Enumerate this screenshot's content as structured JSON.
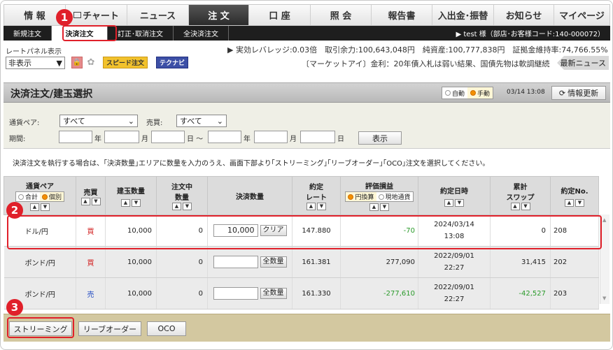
{
  "top_nav": [
    "情 報",
    "チャート",
    "ニュース",
    "注 文",
    "口 座",
    "照 会",
    "報告書",
    "入出金･振替",
    "お知らせ",
    "マイページ"
  ],
  "sub_nav": [
    "新規注文",
    "決済注文",
    "訂正･取消注文",
    "全決済注文"
  ],
  "user_text": "▶ test 様（部店･お客様コード:140-000072）",
  "rate_panel": {
    "label": "レートパネル表示",
    "value": "非表示"
  },
  "speed_order": "スピード注文",
  "technavi": "テクナビ",
  "leverage_text": "▶ 実効レバレッジ:0.03倍　取引余力:100,643,048円　純資産:100,777,838円　証拠金維持率:74,766.55%",
  "news_text": "〔マーケットアイ〕金利：20年債入札は弱い結果、国債先物は軟調継続",
  "news_button": "最新ニュース",
  "panel": {
    "title": "決済注文/建玉選択",
    "auto": "自動",
    "manual": "手動",
    "time": "03/14 13:08",
    "refresh": "情報更新"
  },
  "filter": {
    "pair_label": "通貨ペア:",
    "pair_value": "すべて",
    "side_label": "売買:",
    "side_value": "すべて",
    "period_label": "期間:",
    "year": "年",
    "month": "月",
    "day": "日 ～",
    "year2": "年",
    "month2": "月",
    "day2": "日",
    "show": "表示"
  },
  "note": "決済注文を執行する場合は、｢決済数量｣エリアに数量を入力のうえ、画面下部より｢ストリーミング｣｢リーブオーダー｣｢OCO｣注文を選択してください。",
  "table": {
    "headers": {
      "pair": "通貨ペア",
      "sum": "合計",
      "each": "個別",
      "side": "売買",
      "position_qty": "建玉数量",
      "ordering_qty_1": "注文中",
      "ordering_qty_2": "数量",
      "settle_qty": "決済数量",
      "rate_1": "約定",
      "rate_2": "レート",
      "pl": "評価損益",
      "pl_yen": "円換算",
      "pl_local": "現地通貨",
      "date": "約定日時",
      "swap_1": "累計",
      "swap_2": "スワップ",
      "no": "約定No."
    },
    "rows": [
      {
        "pair": "ドル/円",
        "side": "買",
        "qty": "10,000",
        "ordering": "0",
        "settle": "10,000",
        "btn": "クリア",
        "rate": "147.880",
        "pl": "-70",
        "date1": "2024/03/14",
        "date2": "13:08",
        "swap": "0",
        "no": "208"
      },
      {
        "pair": "ポンド/円",
        "side": "買",
        "qty": "10,000",
        "ordering": "0",
        "settle": "",
        "btn": "全数量",
        "rate": "161.381",
        "pl": "277,090",
        "date1": "2022/09/01",
        "date2": "22:27",
        "swap": "31,415",
        "no": "202"
      },
      {
        "pair": "ポンド/円",
        "side": "売",
        "qty": "10,000",
        "ordering": "0",
        "settle": "",
        "btn": "全数量",
        "rate": "161.330",
        "pl": "-277,610",
        "date1": "2022/09/01",
        "date2": "22:27",
        "swap": "-42,527",
        "no": "203"
      }
    ]
  },
  "footer": {
    "streaming": "ストリーミング",
    "leave": "リーブオーダー",
    "oco": "OCO"
  },
  "badges": [
    "1",
    "2",
    "3"
  ],
  "colors": {
    "accent": "#e0202a",
    "gain": "#2a9a2a",
    "buy": "#d21f1f",
    "sell": "#1f49c2"
  }
}
